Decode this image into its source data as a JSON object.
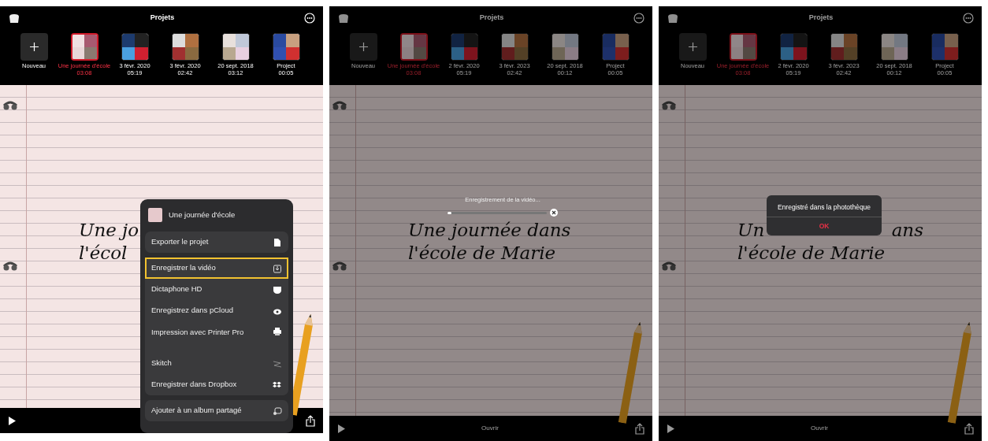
{
  "panels": [
    {
      "kind": "menu",
      "dimmed": false,
      "top_bar": {
        "title": "Projets"
      },
      "projects": [
        {
          "kind": "new",
          "name": "Nouveau",
          "selected": false
        },
        {
          "kind": "project",
          "name": "Une journée d'école",
          "time": "03:08",
          "selected": true
        },
        {
          "kind": "project",
          "name": "3 févr. 2020",
          "time": "05:19",
          "selected": false
        },
        {
          "kind": "project",
          "name": "3 févr. 2020",
          "time": "02:42",
          "selected": false
        },
        {
          "kind": "project",
          "name": "20 sept. 2018",
          "time": "03:12",
          "selected": false
        },
        {
          "kind": "project",
          "name": "Project",
          "time": "00:05",
          "selected": false
        }
      ],
      "canvas": {
        "lines": [
          [
            "Une jo"
          ],
          [
            "l'écol"
          ]
        ]
      },
      "menu": {
        "title": "Une journée d'école",
        "items": [
          {
            "label": "Exporter le projet",
            "highlighted": false
          },
          {
            "label": "Enregistrer la vidéo",
            "highlighted": true
          },
          {
            "label": "Dictaphone HD",
            "highlighted": false
          },
          {
            "label": "Enregistrez dans pCloud",
            "highlighted": false
          },
          {
            "label": "Impression avec Printer Pro",
            "highlighted": false
          },
          {
            "label": "Skitch",
            "highlighted": false
          },
          {
            "label": "Enregistrer dans Dropbox",
            "highlighted": false
          },
          {
            "label": "Ajouter à un album partagé",
            "highlighted": false
          }
        ]
      }
    },
    {
      "kind": "progress",
      "dimmed": true,
      "top_bar": {
        "title": "Projets"
      },
      "projects": [
        {
          "kind": "new",
          "name": "Nouveau",
          "selected": false
        },
        {
          "kind": "project",
          "name": "Une journée d'école",
          "time": "03:08",
          "selected": true
        },
        {
          "kind": "project",
          "name": "2 févr. 2020",
          "time": "05:19",
          "selected": false
        },
        {
          "kind": "project",
          "name": "3 févr. 2023",
          "time": "02:42",
          "selected": false
        },
        {
          "kind": "project",
          "name": "20 sept. 2018",
          "time": "00:12",
          "selected": false
        },
        {
          "kind": "project",
          "name": "Project",
          "time": "00:05",
          "selected": false
        }
      ],
      "canvas": {
        "lines": [
          [
            "Une journée dans"
          ],
          [
            "l'école de Marie"
          ]
        ]
      },
      "bottom_bar": {
        "label": "Ouvrir"
      },
      "progress": {
        "text": "Enregistrement de la vidéo...",
        "level": 0.02
      }
    },
    {
      "kind": "alert",
      "dimmed": true,
      "top_bar": {
        "title": "Projets"
      },
      "projects": [
        {
          "kind": "new",
          "name": "Nouveau",
          "selected": false
        },
        {
          "kind": "project",
          "name": "Une journée d'école",
          "time": "03:08",
          "selected": true
        },
        {
          "kind": "project",
          "name": "2 févr. 2020",
          "time": "05:19",
          "selected": false
        },
        {
          "kind": "project",
          "name": "3 févr. 2023",
          "time": "02:42",
          "selected": false
        },
        {
          "kind": "project",
          "name": "20 sept. 2018",
          "time": "00:12",
          "selected": false
        },
        {
          "kind": "project",
          "name": "Project",
          "time": "00:05",
          "selected": false
        }
      ],
      "canvas": {
        "lines": [
          [
            "Un",
            "ans"
          ],
          [
            "l'école de Marie"
          ]
        ]
      },
      "bottom_bar": {
        "label": "Ouvrir"
      },
      "alert": {
        "message": "Enregistré dans la photothèque",
        "button": "OK"
      }
    }
  ]
}
